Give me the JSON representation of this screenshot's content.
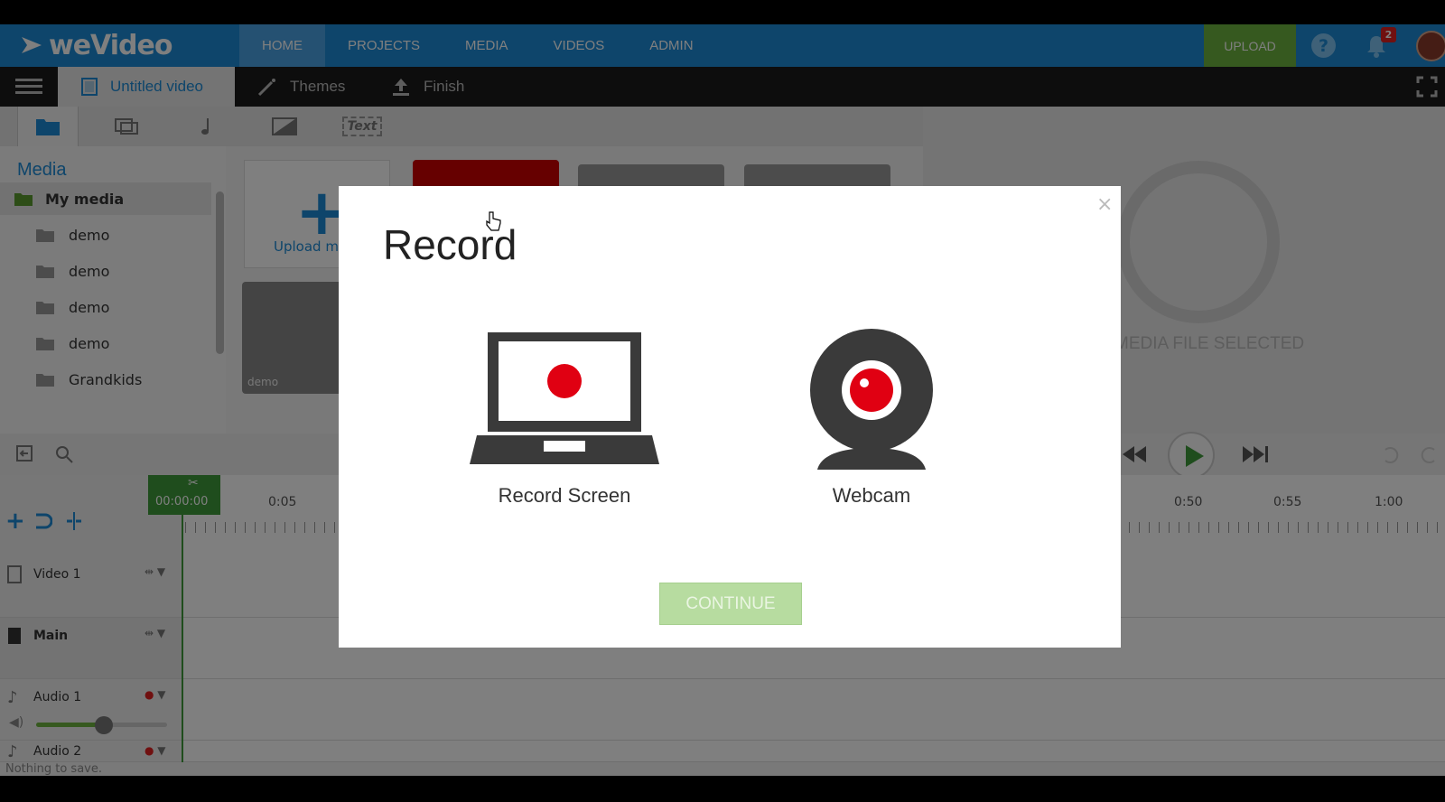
{
  "app": {
    "logo_text": "weVideo",
    "nav": [
      {
        "label": "HOME",
        "active": true
      },
      {
        "label": "PROJECTS"
      },
      {
        "label": "MEDIA"
      },
      {
        "label": "VIDEOS"
      },
      {
        "label": "ADMIN"
      }
    ],
    "upload_label": "UPLOAD",
    "help_symbol": "?",
    "notification_count": "2",
    "accent_color": "#1c8bd6",
    "upload_color": "#6cb33f"
  },
  "toolbar": {
    "project_title": "Untitled video",
    "themes_label": "Themes",
    "finish_label": "Finish"
  },
  "media_panel": {
    "tab_text_label": "Text",
    "title": "Media",
    "my_media_label": "My media",
    "folders": [
      "demo",
      "demo",
      "demo",
      "demo",
      "Grandkids"
    ],
    "upload_tile_label": "Upload me",
    "folder_tile_label": "demo"
  },
  "preview": {
    "no_selection_text": "MEDIA FILE SELECTED"
  },
  "timeline": {
    "playhead_time": "00:00:00",
    "ruler_labels_left": [
      "0:05"
    ],
    "ruler_labels_right": [
      "0:50",
      "0:55",
      "1:00"
    ],
    "tracks": [
      {
        "name": "Video 1"
      },
      {
        "name": "Main"
      },
      {
        "name": "Audio 1"
      },
      {
        "name": "Audio 2"
      }
    ],
    "status_text": "Nothing to save."
  },
  "modal": {
    "title": "Record",
    "close_symbol": "×",
    "options": [
      {
        "label": "Record Screen",
        "icon": "laptop-record-icon"
      },
      {
        "label": "Webcam",
        "icon": "webcam-icon"
      }
    ],
    "continue_label": "CONTINUE",
    "record_color": "#e00012"
  }
}
